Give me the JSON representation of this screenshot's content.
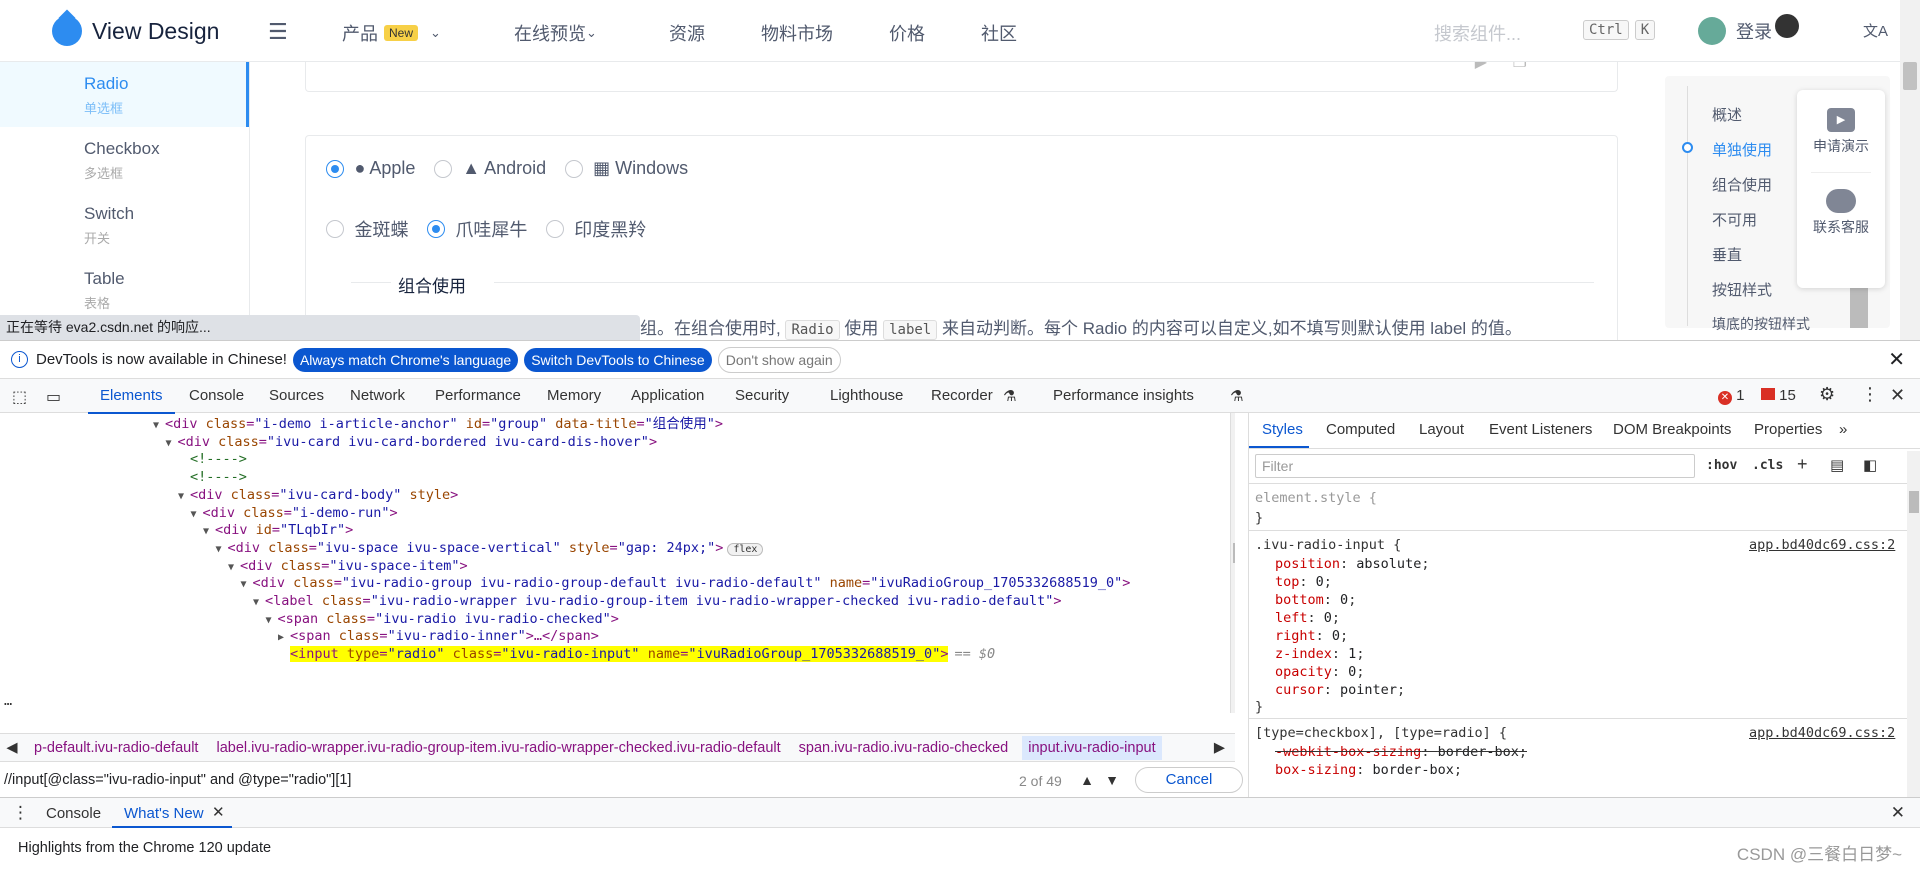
{
  "nav": {
    "logo_text": "View Design",
    "items": [
      "产品",
      "在线预览",
      "资源",
      "物料市场",
      "价格",
      "社区"
    ],
    "new_badge": "New",
    "search_placeholder": "搜索组件...",
    "kbd_ctrl": "Ctrl",
    "kbd_k": "K",
    "login": "登录",
    "lang_icon": "文A"
  },
  "sidebar": {
    "items": [
      {
        "en": "Radio",
        "zh": "单选框",
        "active": true
      },
      {
        "en": "Checkbox",
        "zh": "多选框"
      },
      {
        "en": "Switch",
        "zh": "开关"
      },
      {
        "en": "Table",
        "zh": "表格"
      }
    ]
  },
  "status_loading": "正在等待 eva2.csdn.net 的响应...",
  "demo": {
    "row1": [
      "Apple",
      "Android",
      "Windows"
    ],
    "row2": [
      "金斑蝶",
      "爪哇犀牛",
      "印度黑羚"
    ],
    "section_title": "组合使用",
    "desc_start": "组。在组合使用时,",
    "desc_code1": "Radio",
    "desc_mid1": "使用",
    "desc_code2": "label",
    "desc_end": "来自动判断。每个 Radio 的内容可以自定义,如不填写则默认使用 label 的值。"
  },
  "toc": {
    "items": [
      "概述",
      "单独使用",
      "组合使用",
      "不可用",
      "垂直",
      "按钮样式",
      "填底的按钮样式"
    ],
    "active_index": 1
  },
  "float": {
    "demo_label": "申请演示",
    "service_label": "联系客服"
  },
  "devtools": {
    "infobar": {
      "text": "DevTools is now available in Chinese!",
      "btn1": "Always match Chrome's language",
      "btn2": "Switch DevTools to Chinese",
      "btn3": "Don't show again"
    },
    "tabs": [
      "Elements",
      "Console",
      "Sources",
      "Network",
      "Performance",
      "Memory",
      "Application",
      "Security",
      "Lighthouse",
      "Recorder",
      "Performance insights"
    ],
    "errors": "1",
    "warnings": "15",
    "styles_tabs": [
      "Styles",
      "Computed",
      "Layout",
      "Event Listeners",
      "DOM Breakpoints",
      "Properties"
    ],
    "filter_placeholder": "Filter",
    "hov": ":hov",
    "cls": ".cls",
    "breadcrumbs": [
      "p-default.ivu-radio-default",
      "label.ivu-radio-wrapper.ivu-radio-group-item.ivu-radio-wrapper-checked.ivu-radio-default",
      "span.ivu-radio.ivu-radio-checked",
      "input.ivu-radio-input"
    ],
    "search_query": "//input[@class=\"ivu-radio-input\" and @type=\"radio\"][1]",
    "search_count": "2 of 49",
    "cancel": "Cancel",
    "drawer_tabs": [
      "Console",
      "What's New"
    ],
    "drawer_text": "Highlights from the Chrome 120 update",
    "source_file": "app.bd40dc69.css:2",
    "element_style": "element.style {",
    "rule1_selector": ".ivu-radio-input {",
    "rule1_props": [
      [
        "position",
        "absolute"
      ],
      [
        "top",
        "0"
      ],
      [
        "bottom",
        "0"
      ],
      [
        "left",
        "0"
      ],
      [
        "right",
        "0"
      ],
      [
        "z-index",
        "1"
      ],
      [
        "opacity",
        "0"
      ],
      [
        "cursor",
        "pointer"
      ]
    ],
    "rule2_selector": "[type=checkbox], [type=radio] {",
    "rule2_props": [
      [
        "-webkit-box-sizing",
        "border-box"
      ],
      [
        "box-sizing",
        "border-box"
      ]
    ],
    "dom_lines": [
      {
        "indent": 0,
        "arrow": "▼",
        "html": "<div class=\"i-demo i-article-anchor\" id=\"group\" data-title=\"组合使用\">"
      },
      {
        "indent": 1,
        "arrow": "▼",
        "html": "<div class=\"ivu-card ivu-card-bordered ivu-card-dis-hover\">"
      },
      {
        "indent": 2,
        "arrow": "",
        "html": "<!---->"
      },
      {
        "indent": 2,
        "arrow": "",
        "html": "<!---->"
      },
      {
        "indent": 2,
        "arrow": "▼",
        "html": "<div class=\"ivu-card-body\" style>"
      },
      {
        "indent": 3,
        "arrow": "▼",
        "html": "<div class=\"i-demo-run\">"
      },
      {
        "indent": 4,
        "arrow": "▼",
        "html": "<div id=\"TLqbIr\">"
      },
      {
        "indent": 5,
        "arrow": "▼",
        "html": "<div class=\"ivu-space ivu-space-vertical\" style=\"gap: 24px;\">"
      },
      {
        "indent": 6,
        "arrow": "▼",
        "html": "<div class=\"ivu-space-item\">"
      },
      {
        "indent": 7,
        "arrow": "▼",
        "html": "<div class=\"ivu-radio-group ivu-radio-group-default ivu-radio-default\" name=\"ivuRadioGroup_1705332688519_0\">"
      },
      {
        "indent": 8,
        "arrow": "▼",
        "html": "<label class=\"ivu-radio-wrapper ivu-radio-group-item ivu-radio-wrapper-checked ivu-radio-default\">"
      },
      {
        "indent": 9,
        "arrow": "▼",
        "html": "<span class=\"ivu-radio ivu-radio-checked\">"
      },
      {
        "indent": 10,
        "arrow": "▶",
        "html": "<span class=\"ivu-radio-inner\">…</span>"
      },
      {
        "indent": 10,
        "arrow": "",
        "html": "<input type=\"radio\" class=\"ivu-radio-input\" name=\"ivuRadioGroup_1705332688519_0\">"
      }
    ],
    "flex_badge": "flex",
    "dollar0": "== $0"
  },
  "watermark": "CSDN @三餐白日梦~"
}
